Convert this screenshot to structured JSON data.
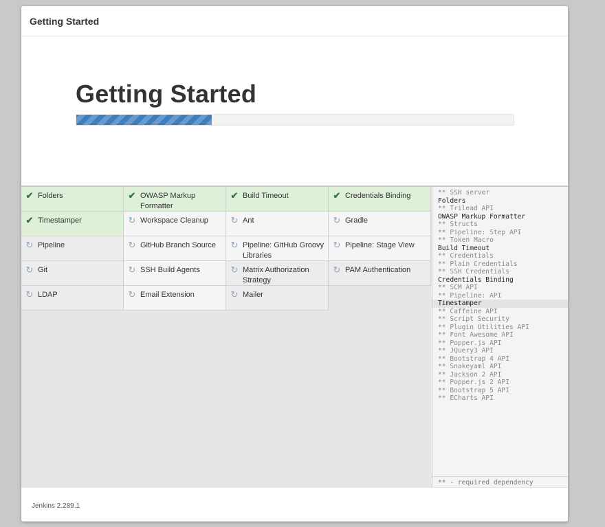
{
  "dialog": {
    "title": "Getting Started",
    "hero_title": "Getting Started",
    "progress_fraction": 0.31
  },
  "plugins": [
    {
      "label": "Folders",
      "status": "done",
      "icon": "check-icon"
    },
    {
      "label": "OWASP Markup Formatter",
      "status": "done",
      "icon": "check-icon"
    },
    {
      "label": "Build Timeout",
      "status": "done",
      "icon": "check-icon"
    },
    {
      "label": "Credentials Binding",
      "status": "done",
      "icon": "check-icon"
    },
    {
      "label": "Timestamper",
      "status": "done",
      "icon": "check-icon"
    },
    {
      "label": "Workspace Cleanup",
      "status": "pending",
      "icon": "refresh-icon"
    },
    {
      "label": "Ant",
      "status": "pending",
      "icon": "refresh-icon"
    },
    {
      "label": "Gradle",
      "status": "pending",
      "icon": "refresh-icon"
    },
    {
      "label": "Pipeline",
      "status": "queued",
      "icon": "refresh-icon"
    },
    {
      "label": "GitHub Branch Source",
      "status": "pending",
      "icon": "refresh-icon"
    },
    {
      "label": "Pipeline: GitHub Groovy Libraries",
      "status": "pending",
      "icon": "refresh-icon"
    },
    {
      "label": "Pipeline: Stage View",
      "status": "pending",
      "icon": "refresh-icon"
    },
    {
      "label": "Git",
      "status": "queued",
      "icon": "refresh-icon"
    },
    {
      "label": "SSH Build Agents",
      "status": "pending",
      "icon": "refresh-icon"
    },
    {
      "label": "Matrix Authorization Strategy",
      "status": "queued",
      "icon": "refresh-icon"
    },
    {
      "label": "PAM Authentication",
      "status": "queued",
      "icon": "refresh-icon"
    },
    {
      "label": "LDAP",
      "status": "queued",
      "icon": "refresh-icon"
    },
    {
      "label": "Email Extension",
      "status": "pending",
      "icon": "refresh-icon"
    },
    {
      "label": "Mailer",
      "status": "queued",
      "icon": "refresh-icon"
    }
  ],
  "dependencies": {
    "lines": [
      {
        "text": "** SSH server",
        "header": false
      },
      {
        "text": "Folders",
        "header": true
      },
      {
        "text": "** Trilead API",
        "header": false
      },
      {
        "text": "OWASP Markup Formatter",
        "header": true
      },
      {
        "text": "** Structs",
        "header": false
      },
      {
        "text": "** Pipeline: Step API",
        "header": false
      },
      {
        "text": "** Token Macro",
        "header": false
      },
      {
        "text": "Build Timeout",
        "header": true
      },
      {
        "text": "** Credentials",
        "header": false
      },
      {
        "text": "** Plain Credentials",
        "header": false
      },
      {
        "text": "** SSH Credentials",
        "header": false
      },
      {
        "text": "Credentials Binding",
        "header": true
      },
      {
        "text": "** SCM API",
        "header": false
      },
      {
        "text": "** Pipeline: API",
        "header": false
      },
      {
        "text": "Timestamper",
        "header": true,
        "highlight": true
      },
      {
        "text": "** Caffeine API",
        "header": false
      },
      {
        "text": "** Script Security",
        "header": false
      },
      {
        "text": "** Plugin Utilities API",
        "header": false
      },
      {
        "text": "** Font Awesome API",
        "header": false
      },
      {
        "text": "** Popper.js API",
        "header": false
      },
      {
        "text": "** JQuery3 API",
        "header": false
      },
      {
        "text": "** Bootstrap 4 API",
        "header": false
      },
      {
        "text": "** Snakeyaml API",
        "header": false
      },
      {
        "text": "** Jackson 2 API",
        "header": false
      },
      {
        "text": "** Popper.js 2 API",
        "header": false
      },
      {
        "text": "** Bootstrap 5 API",
        "header": false
      },
      {
        "text": "** ECharts API",
        "header": false
      }
    ],
    "footer": "** - required dependency"
  },
  "footer": {
    "version": "Jenkins 2.289.1"
  },
  "colors": {
    "progress": "#3f7ebd",
    "done_bg": "#dff0d8",
    "check": "#3c763d"
  }
}
